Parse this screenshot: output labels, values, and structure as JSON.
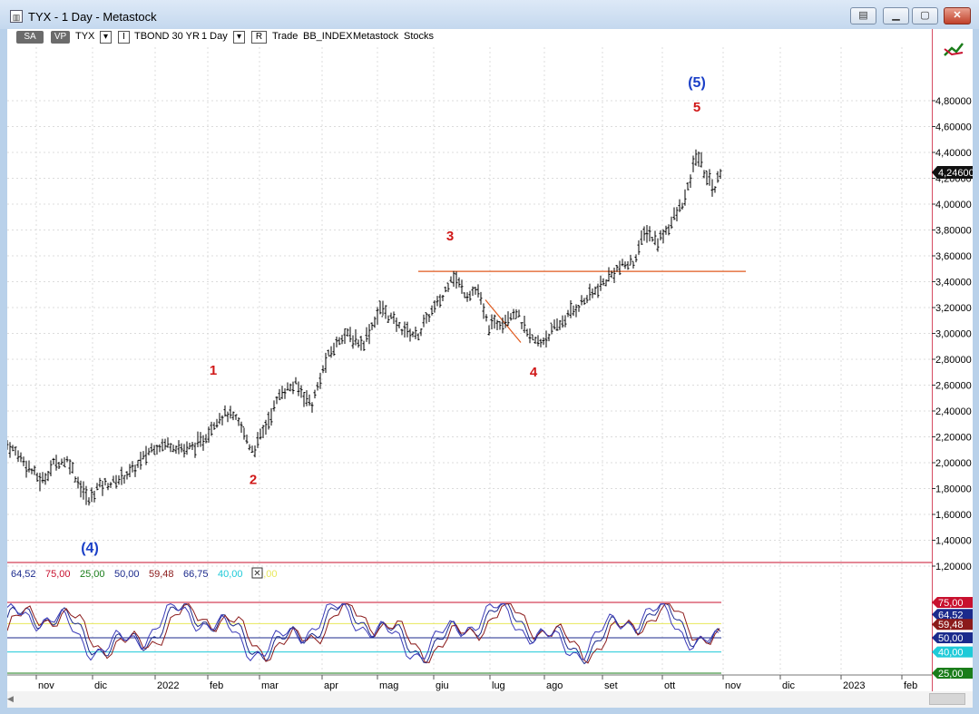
{
  "window": {
    "title": "TYX - 1 Day - Metastock",
    "icon": "chart-icon",
    "controls": [
      "restore-icon",
      "minimize-icon",
      "maximize-icon",
      "close-icon"
    ]
  },
  "toolbar": {
    "sa_label": "SA",
    "vp_label": "VP",
    "symbol": "TYX",
    "i_label": "I",
    "security_name": "TBOND 30 YR",
    "periodicity": "1 Day",
    "r_label": "R",
    "items": [
      "Trade",
      "BB_INDEX",
      "Metastock",
      "Stocks"
    ]
  },
  "price_axis": {
    "ticks": [
      "4,80000",
      "4,60000",
      "4,40000",
      "4,20000",
      "4,00000",
      "3,80000",
      "3,60000",
      "3,40000",
      "3,20000",
      "3,00000",
      "2,80000",
      "2,60000",
      "2,40000",
      "2,20000",
      "2,00000",
      "1,80000",
      "1,60000",
      "1,40000",
      "1,20000"
    ],
    "last_price": "4,24600"
  },
  "indicator_values": [
    {
      "text": "64,52",
      "color": "#1b2a8c"
    },
    {
      "text": "75,00",
      "color": "#c8102e"
    },
    {
      "text": "25,00",
      "color": "#1a7d1a"
    },
    {
      "text": "50,00",
      "color": "#1b2a8c"
    },
    {
      "text": "59,48",
      "color": "#8b1a1a"
    },
    {
      "text": "66,75",
      "color": "#1b2a8c"
    },
    {
      "text": "40,00",
      "color": "#1ecad8"
    },
    {
      "text": "60,00",
      "color": "#e8e85a"
    }
  ],
  "indicator_axis": {
    "tags": [
      {
        "text": "75,00",
        "color": "#c8102e"
      },
      {
        "text": "64,52",
        "color": "#1b2a8c"
      },
      {
        "text": "59,48",
        "color": "#8b1a1a"
      },
      {
        "text": "50,00",
        "color": "#1b2a8c"
      },
      {
        "text": "40,00",
        "color": "#1ecad8"
      },
      {
        "text": "25,00",
        "color": "#1a7d1a"
      }
    ]
  },
  "time_axis": [
    "nov",
    "dic",
    "2022",
    "feb",
    "mar",
    "apr",
    "mag",
    "giu",
    "lug",
    "ago",
    "set",
    "ott",
    "nov",
    "dic",
    "2023",
    "feb"
  ],
  "wave_labels": [
    {
      "text": "(4)",
      "color": "#1a3fc7"
    },
    {
      "text": "1",
      "color": "#d01818"
    },
    {
      "text": "2",
      "color": "#d01818"
    },
    {
      "text": "3",
      "color": "#d01818"
    },
    {
      "text": "4",
      "color": "#d01818"
    },
    {
      "text": "5",
      "color": "#d01818"
    },
    {
      "text": "(5)",
      "color": "#1a3fc7"
    }
  ],
  "colors": {
    "price_bars": "#000000",
    "resistance_line": "#e05a1e",
    "separator": "#c8102e",
    "grid": "#dcdcdc"
  },
  "chart_data": {
    "type": "line",
    "title": "TYX - 1 Day",
    "series": [
      {
        "name": "TYX",
        "x": [
          "nov 2021",
          "dic 2021",
          "2022",
          "feb",
          "mar",
          "apr",
          "mag",
          "giu",
          "lug",
          "ago",
          "set",
          "ott",
          "nov"
        ],
        "values": [
          1.98,
          1.78,
          2.05,
          2.22,
          2.28,
          2.7,
          3.05,
          3.3,
          3.1,
          3.0,
          3.55,
          3.85,
          4.25
        ]
      }
    ],
    "ylim": [
      1.2,
      4.8
    ],
    "key_levels": {
      "wave_4_prior_low": 1.7,
      "wave_1_high": 2.38,
      "wave_2_low": 2.08,
      "wave_3_high": 3.46,
      "wave_4_low": 2.9,
      "wave_5_high": 4.4,
      "resistance": 3.48,
      "last": 4.246
    },
    "oscillator_levels": [
      75,
      60,
      50,
      40,
      25
    ],
    "grid": true
  }
}
